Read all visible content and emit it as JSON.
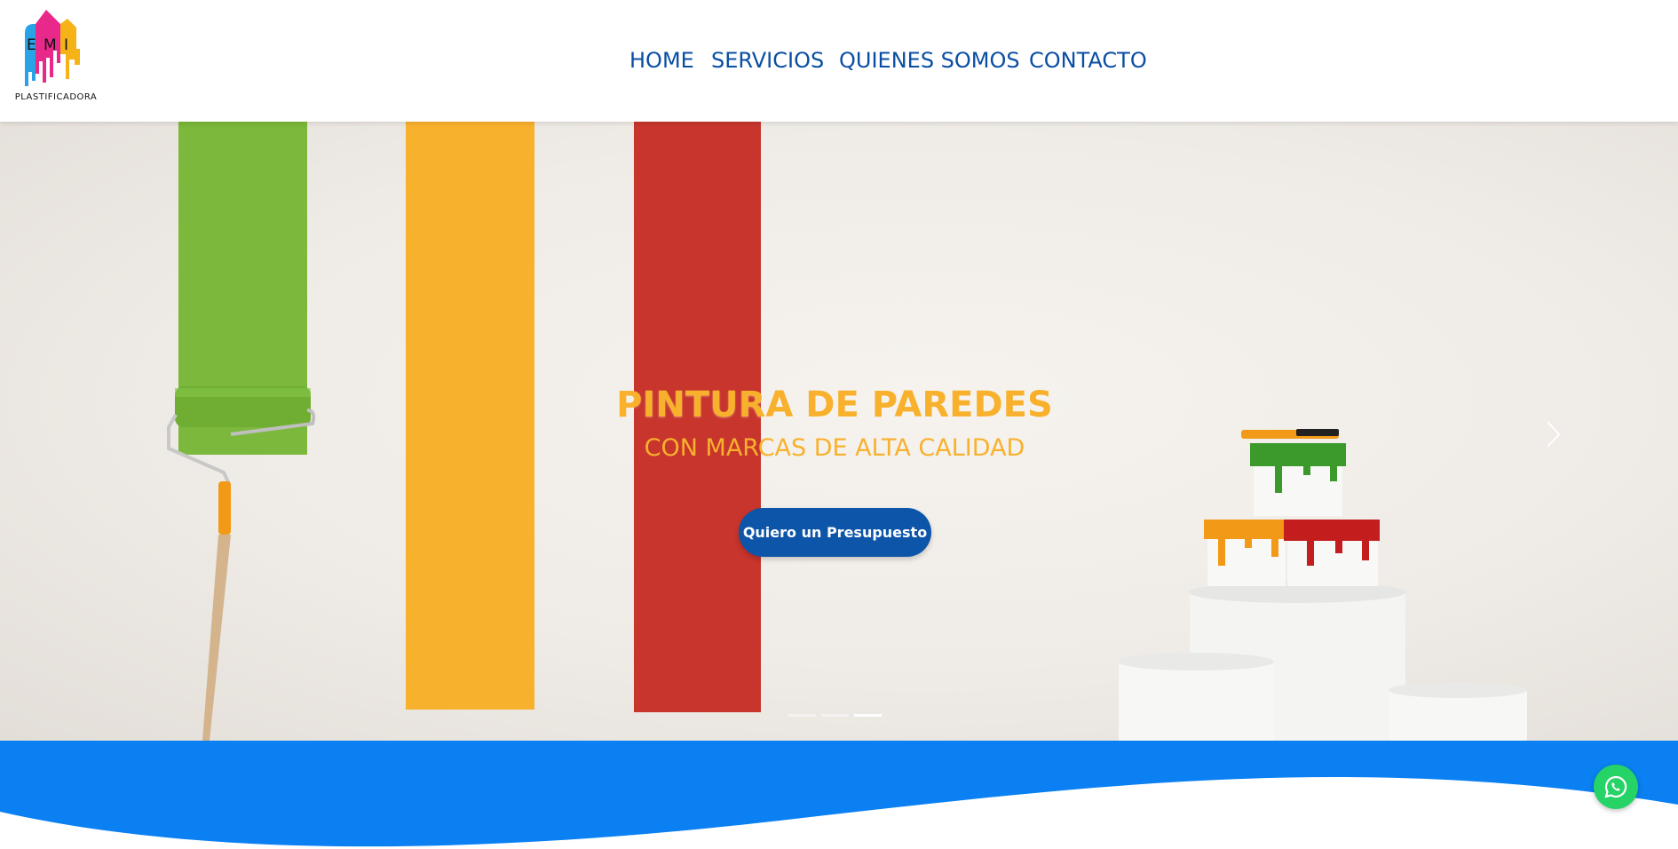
{
  "brand": {
    "logo_letters": [
      "E",
      "M",
      "I"
    ],
    "logo_word": "PLASTIFICADORA",
    "logo_colors": [
      "#2aa3e6",
      "#e8288a",
      "#f6b317"
    ]
  },
  "nav": {
    "home": "HOME",
    "servicios": "SERVICIOS",
    "quienes": "QUIENES SOMOS",
    "contacto": "CONTACTO"
  },
  "hero": {
    "title": "PINTURA DE PAREDES",
    "subtitle": "CON MARCAS DE ALTA CALIDAD",
    "cta_label": "Quiero un Presupuesto",
    "slide_count": 3,
    "active_slide": 3,
    "paint_colors": [
      "#7bb83b",
      "#f8b12d",
      "#c7352c"
    ]
  },
  "icons": {
    "next": "chevron-right-icon",
    "whatsapp": "whatsapp-icon"
  },
  "colors": {
    "nav_text": "#0a4ea3",
    "accent": "#f8b12d",
    "cta_bg": "#0d55a8",
    "wave_blue": "#0a80f2",
    "whatsapp": "#25d366"
  }
}
